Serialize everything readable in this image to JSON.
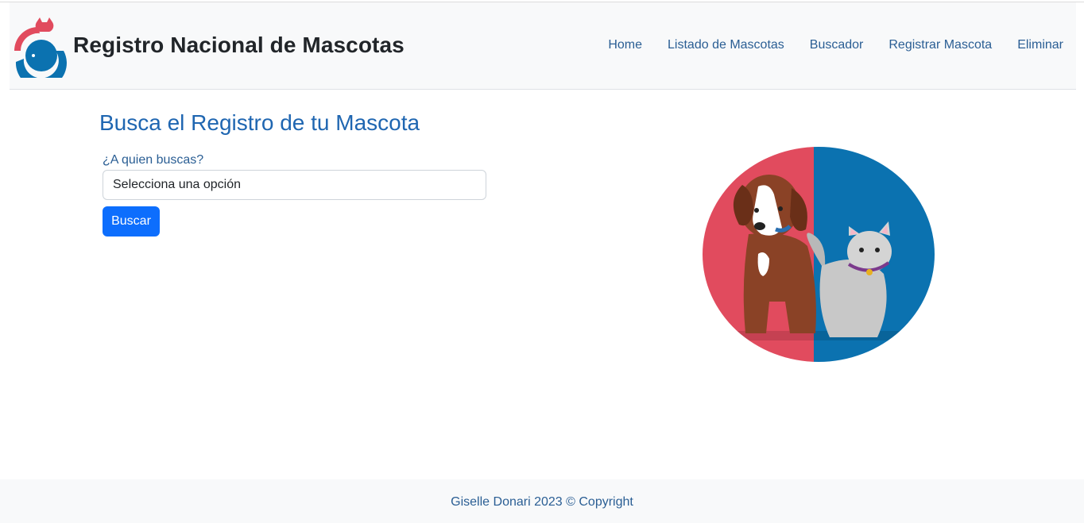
{
  "header": {
    "brand": "Registro Nacional de Mascotas",
    "logo_icon": "cat-dog-circle-logo-icon",
    "nav": [
      "Home",
      "Listado de Mascotas",
      "Buscador",
      "Registrar Mascota",
      "Eliminar"
    ]
  },
  "main": {
    "title": "Busca el Registro de tu Mascota",
    "field_label": "¿A quien buscas?",
    "select_value": "Selecciona una opción",
    "search_button": "Buscar",
    "hero_image": "dog-and-cat-illustration"
  },
  "footer": {
    "text": "Giselle Donari 2023 © Copyright"
  },
  "colors": {
    "accent": "#0d6efd",
    "title": "#1f66b1",
    "link": "#2a5e94",
    "hero_red": "#e14b5e",
    "hero_blue": "#0b72b0"
  }
}
